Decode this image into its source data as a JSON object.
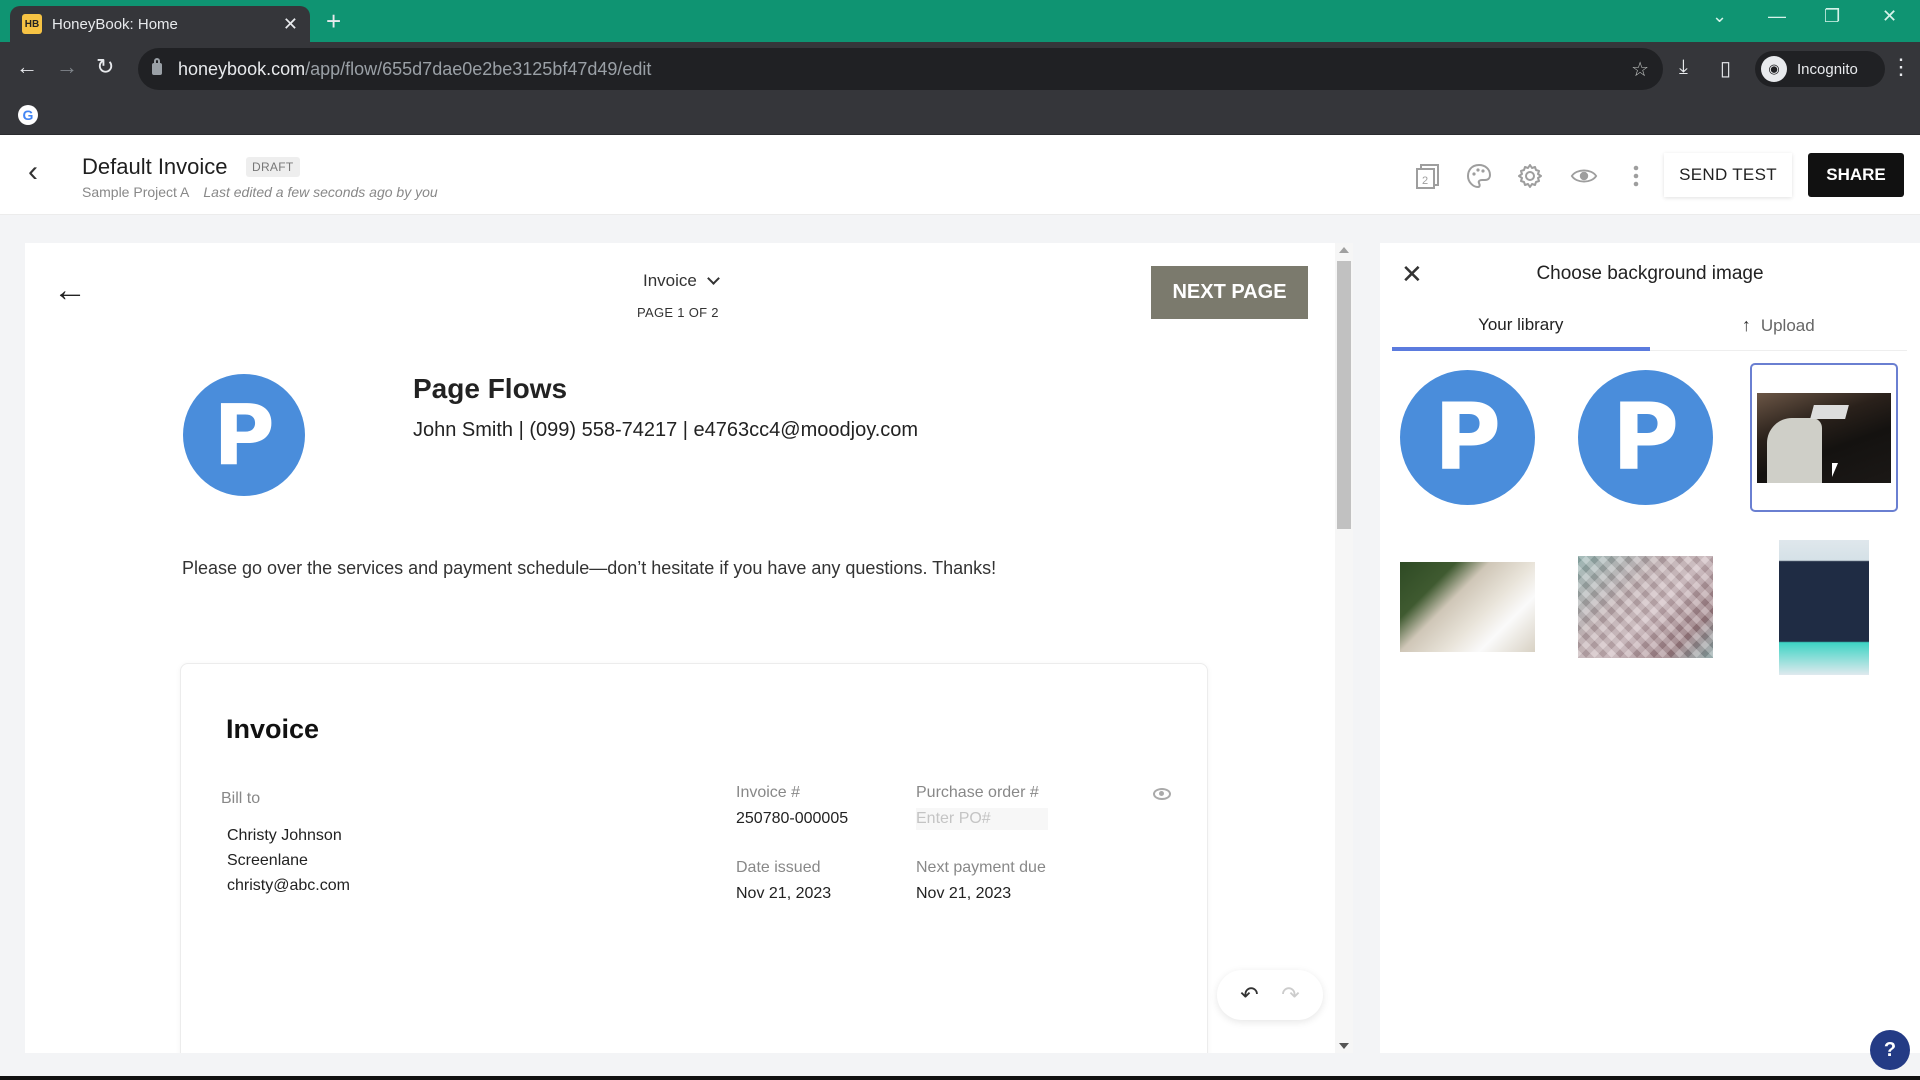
{
  "browser": {
    "tab_title": "HoneyBook: Home",
    "tab_favicon": "HB",
    "url_host": "honeybook.com",
    "url_path": "/app/flow/655d7dae0e2be3125bf47d49/edit",
    "profile_label": "Incognito",
    "icons": {
      "back": "←",
      "forward": "→",
      "reload": "↻",
      "star": "☆",
      "download": "⤓",
      "sidepanel": "▯",
      "menu": "⋮",
      "new_tab": "+",
      "close_tab": "✕",
      "tab_search": "⌄",
      "minimize": "—",
      "restore": "❐",
      "close_window": "✕"
    }
  },
  "header": {
    "back_icon": "‹",
    "title": "Default Invoice",
    "badge": "DRAFT",
    "project": "Sample Project A",
    "last_edited": "Last edited a few seconds ago by you",
    "pages_count_icon_label": "2",
    "send_test_label": "SEND TEST",
    "share_label": "SHARE"
  },
  "canvas": {
    "back_icon": "←",
    "page_selector_label": "Invoice",
    "page_indicator": "PAGE 1 OF 2",
    "next_page_label": "NEXT PAGE",
    "brand_initial": "P",
    "company_name": "Page Flows",
    "company_contact": "John Smith | (099) 558-74217 | e4763cc4@moodjoy.com",
    "message": "Please go over the services and payment schedule—don’t hesitate if you have any questions. Thanks!",
    "invoice": {
      "title": "Invoice",
      "bill_to_label": "Bill to",
      "bill_to_name": "Christy Johnson",
      "bill_to_company": "Screenlane",
      "bill_to_email": "christy@abc.com",
      "invoice_number_label": "Invoice #",
      "invoice_number": "250780-000005",
      "po_label": "Purchase order #",
      "po_value": "",
      "po_placeholder": "Enter PO#",
      "date_issued_label": "Date issued",
      "date_issued": "Nov 21, 2023",
      "next_payment_label": "Next payment due",
      "next_payment": "Nov 21, 2023"
    },
    "undo_icon": "↶",
    "redo_icon": "↷"
  },
  "panel": {
    "close_icon": "✕",
    "title": "Choose background image",
    "tabs": [
      {
        "label": "Your library",
        "active": true
      },
      {
        "label": "Upload",
        "icon": "↑",
        "active": false
      }
    ],
    "images": [
      {
        "name": "logo-p-1",
        "initial": "P"
      },
      {
        "name": "logo-p-2",
        "initial": "P"
      },
      {
        "name": "office-chair-desk",
        "selected": true
      },
      {
        "name": "coffee-notebook-plant"
      },
      {
        "name": "pastel-tiles"
      },
      {
        "name": "phone-dashboard"
      }
    ]
  },
  "help_label": "?"
}
